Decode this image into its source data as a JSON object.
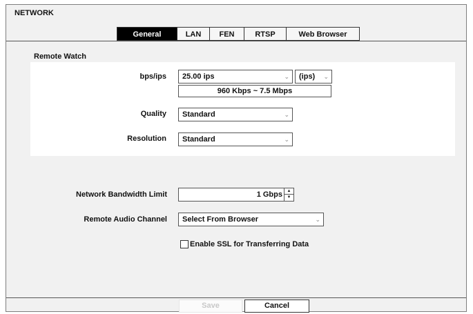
{
  "window": {
    "title": "NETWORK"
  },
  "tabs": [
    {
      "label": "General",
      "active": true
    },
    {
      "label": "LAN",
      "active": false
    },
    {
      "label": "FEN",
      "active": false
    },
    {
      "label": "RTSP",
      "active": false
    },
    {
      "label": "Web Browser",
      "active": false
    }
  ],
  "remote_watch": {
    "section_label": "Remote Watch",
    "bps": {
      "label": "bps/ips",
      "value": "25.00 ips",
      "unit": "(ips)",
      "bandwidth_text": "960 Kbps ~ 7.5 Mbps"
    },
    "quality": {
      "label": "Quality",
      "value": "Standard"
    },
    "resolution": {
      "label": "Resolution",
      "value": "Standard"
    }
  },
  "bandwidth_limit": {
    "label": "Network Bandwidth Limit",
    "value": "1 Gbps"
  },
  "audio_channel": {
    "label": "Remote Audio Channel",
    "value": "Select From Browser"
  },
  "ssl": {
    "label": "Enable SSL for Transferring Data",
    "checked": false
  },
  "buttons": {
    "save": "Save",
    "cancel": "Cancel"
  },
  "icons": {
    "dropdown": "chevron-down-icon",
    "spin_up": "arrow-up-icon",
    "spin_down": "arrow-down-icon"
  },
  "colors": {
    "active_tab_bg": "#000000",
    "panel_bg": "#f1f1f1",
    "group_bg": "#ffffff"
  }
}
